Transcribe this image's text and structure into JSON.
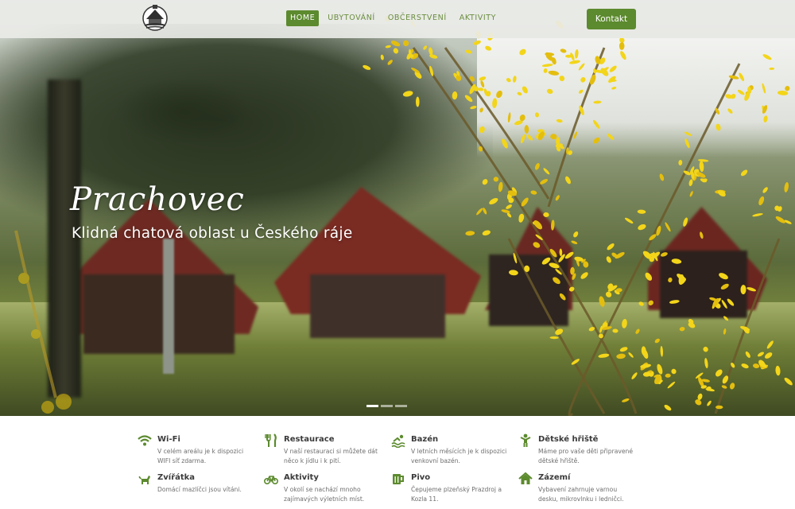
{
  "nav": {
    "logo_icon": "chatova-oblast-logo",
    "links": [
      {
        "label": "HOME",
        "active": true
      },
      {
        "label": "UBYTOVÁNÍ",
        "active": false
      },
      {
        "label": "OBČERSTVENÍ",
        "active": false
      },
      {
        "label": "AKTIVITY",
        "active": false
      }
    ],
    "contact_label": "Kontakt"
  },
  "hero": {
    "title": "Prachovec",
    "subtitle": "Klidná chatová oblast u Českého ráje",
    "slides_total": 3,
    "active_slide": 1
  },
  "features": [
    {
      "icon": "wifi-icon",
      "title": "Wi-Fi",
      "desc": "V celém areálu je k dispozici WIFI síť zdarma."
    },
    {
      "icon": "restaurant-icon",
      "title": "Restaurace",
      "desc": "V naší restauraci si můžete dát něco k jídlu i k pití."
    },
    {
      "icon": "swimming-icon",
      "title": "Bazén",
      "desc": "V letních měsících je k dispozici venkovní bazén."
    },
    {
      "icon": "child-icon",
      "title": "Dětské hřiště",
      "desc": "Máme pro vaše děti připravené dětské hřiště."
    },
    {
      "icon": "dog-icon",
      "title": "Zvířátka",
      "desc": "Domácí mazlíčci jsou vítáni."
    },
    {
      "icon": "bicycle-icon",
      "title": "Aktivity",
      "desc": "V okolí se nachází mnoho zajímavých výletních míst."
    },
    {
      "icon": "beer-icon",
      "title": "Pivo",
      "desc": "Čepujeme plzeňský Prazdroj a Kozla 11."
    },
    {
      "icon": "home-icon",
      "title": "Zázemí",
      "desc": "Vybavení zahrnuje varnou desku, mikrovlnku i ledničci."
    }
  ],
  "colors": {
    "accent": "#5c8a2e",
    "nav_text": "#6b8d3e",
    "feature_title": "#3b3b3b",
    "feature_desc": "#6e6e6e"
  }
}
